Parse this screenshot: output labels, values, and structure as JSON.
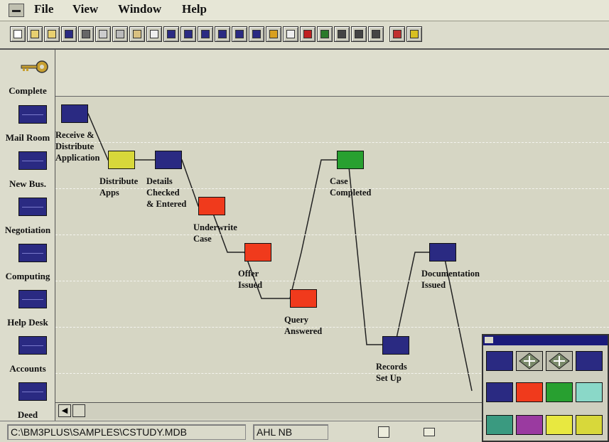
{
  "menubar": {
    "items": [
      "File",
      "View",
      "Window",
      "Help"
    ]
  },
  "toolbar": {
    "buttons": [
      "new-doc-icon",
      "open-folder-icon",
      "open-icon",
      "save-icon",
      "print-icon",
      "cut-icon",
      "copy-icon",
      "paste-icon",
      "properties-icon",
      "form-icon",
      "table-icon",
      "bar-chart-icon",
      "line-chart-icon",
      "org-chart-icon",
      "database-icon",
      "key-icon",
      "help-icon",
      "query-icon",
      "grid-icon",
      "camera-icon",
      "report-icon",
      "video-icon",
      "network-icon",
      "wand-icon"
    ]
  },
  "lanes": [
    {
      "label": "Complete",
      "icon": "key-icon"
    },
    {
      "label": "Mail Room",
      "icon": "lane-icon"
    },
    {
      "label": "New Bus.",
      "icon": "lane-icon"
    },
    {
      "label": "Negotiation",
      "icon": "lane-icon"
    },
    {
      "label": "Computing",
      "icon": "lane-icon"
    },
    {
      "label": "Help Desk",
      "icon": "lane-icon"
    },
    {
      "label": "Accounts",
      "icon": "lane-icon"
    },
    {
      "label": "Deed",
      "icon": "lane-icon"
    }
  ],
  "process": {
    "nodes": [
      {
        "label": "Receive &\nDistribute\nApplication",
        "color": "#2a2a82"
      },
      {
        "label": "Distribute\nApps",
        "color": "#d8d83a"
      },
      {
        "label": "Details\nChecked\n& Entered",
        "color": "#2a2a82"
      },
      {
        "label": "Underwrite\nCase",
        "color": "#f03a1c"
      },
      {
        "label": "Offer\nIssued",
        "color": "#f03a1c"
      },
      {
        "label": "Query\nAnswered",
        "color": "#f03a1c"
      },
      {
        "label": "Case\nCompleted",
        "color": "#28a030"
      },
      {
        "label": "Records\nSet Up",
        "color": "#2a2a82"
      },
      {
        "label": "Documentation\nIssued",
        "color": "#2a2a82"
      }
    ]
  },
  "statusbar": {
    "path": "C:\\BM3PLUS\\SAMPLES\\CSTUDY.MDB",
    "model": "AHL NB"
  },
  "palette": {
    "swatches": [
      "#2a2a82",
      "node-shape-icon",
      "node-shape-icon",
      "#2a2a82",
      "#2a2a82",
      "#f03a1c",
      "#28a030",
      "#8ad8c8",
      "#3a9a80",
      "#9a3aa0",
      "#e8e840",
      "#d8d83a"
    ]
  },
  "colors": {
    "navy": "#2a2a82",
    "red": "#f03a1c",
    "green": "#28a030",
    "yellow": "#d8d83a"
  }
}
